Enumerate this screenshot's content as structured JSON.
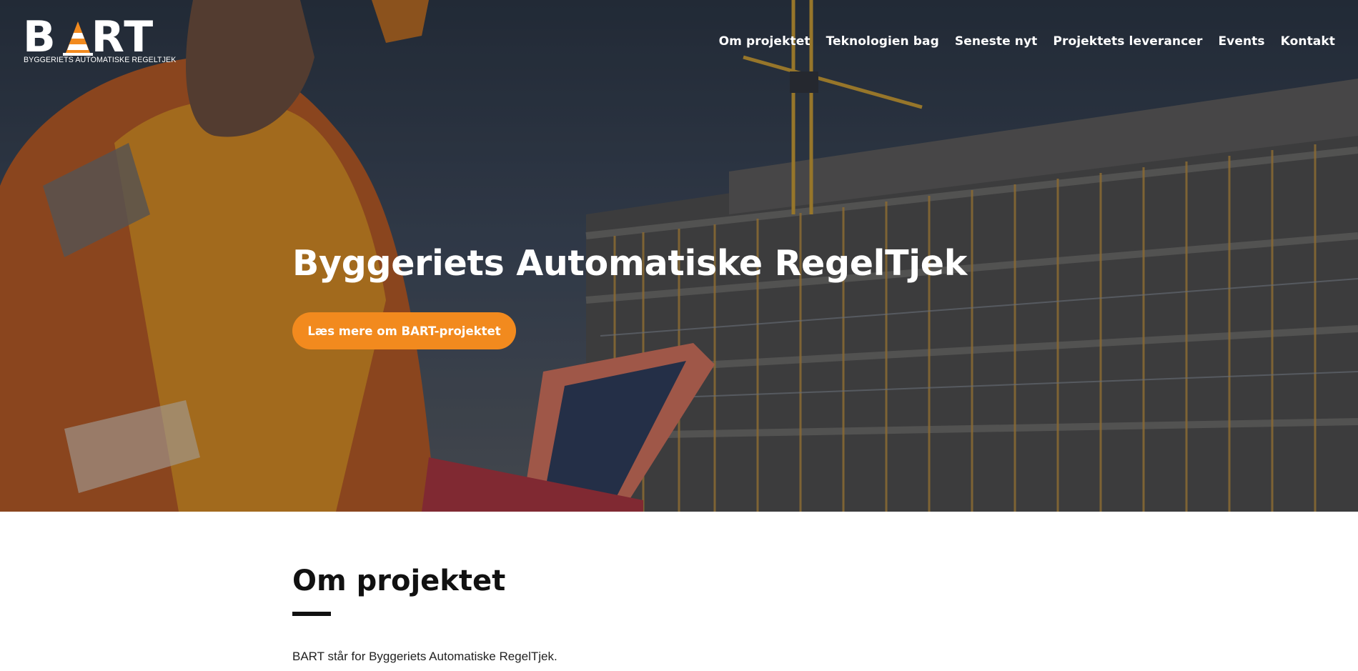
{
  "brand": {
    "logo_text": "BART",
    "logo_subtitle": "BYGGERIETS AUTOMATISKE REGELTJEK"
  },
  "nav": {
    "items": [
      {
        "label": "Om projektet"
      },
      {
        "label": "Teknologien bag"
      },
      {
        "label": "Seneste nyt"
      },
      {
        "label": "Projektets leverancer"
      },
      {
        "label": "Events"
      },
      {
        "label": "Kontakt"
      }
    ]
  },
  "hero": {
    "title": "Byggeriets Automatiske RegelTjek",
    "cta_label": "Læs mere om BART-projektet"
  },
  "about": {
    "title": "Om projektet",
    "text": "BART står for Byggeriets Automatiske RegelTjek."
  },
  "colors": {
    "accent": "#f28a1e",
    "text_dark": "#111111",
    "nav_text": "#ffffff"
  },
  "icons": {
    "logo_cone": "traffic-cone-icon"
  }
}
